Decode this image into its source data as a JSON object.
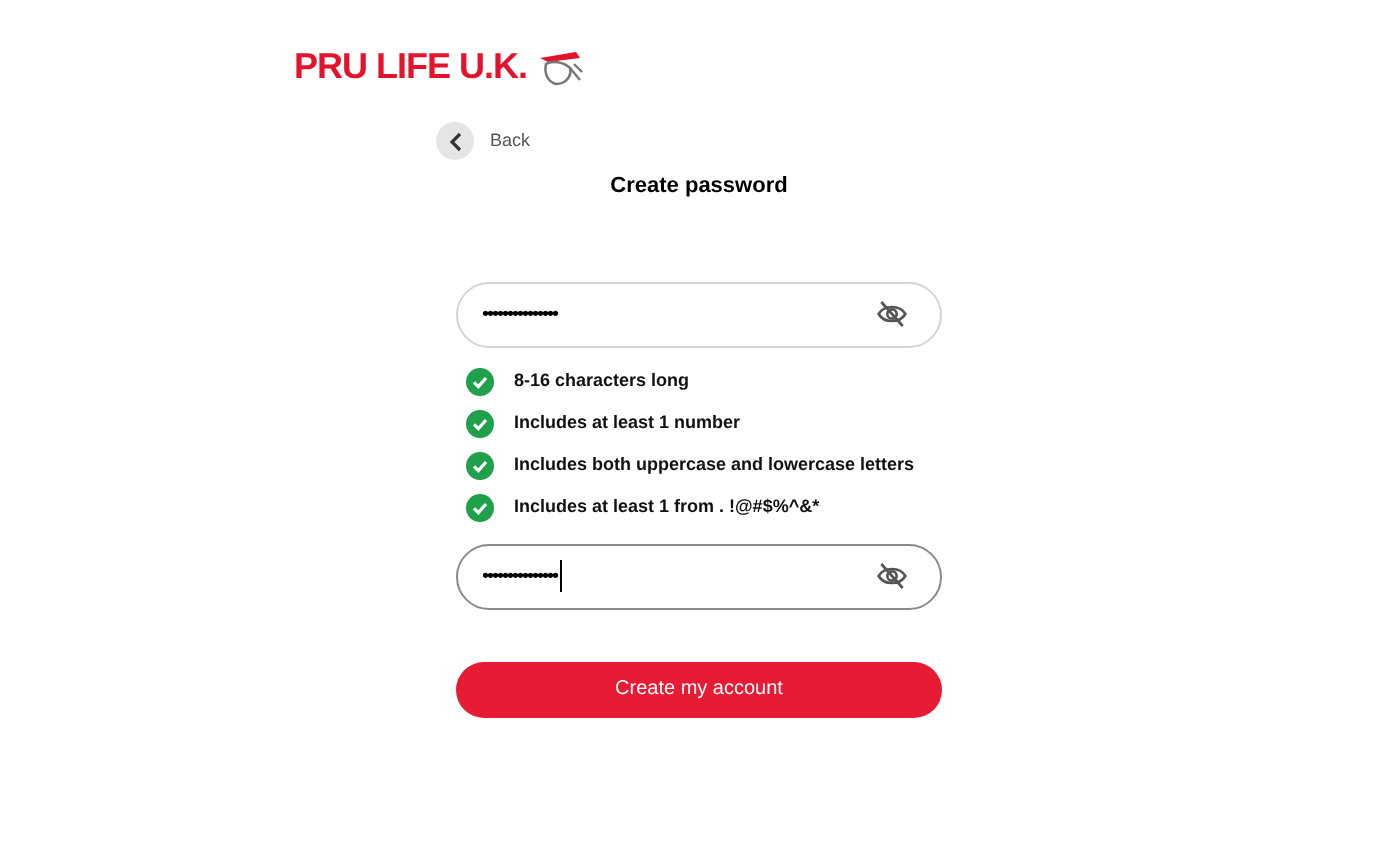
{
  "logo": {
    "text": "PRU LIFE U.K."
  },
  "back": {
    "label": "Back"
  },
  "title": "Create password",
  "password_fields": [
    {
      "value": "•••••••••••••••",
      "focused": false
    },
    {
      "value": "•••••••••••••••",
      "focused": true
    }
  ],
  "requirements": [
    {
      "text": "8-16 characters long",
      "met": true
    },
    {
      "text": "Includes at least 1 number",
      "met": true
    },
    {
      "text": "Includes both uppercase and lowercase letters",
      "met": true
    },
    {
      "text": "Includes at least 1 from . !@#$%^&*",
      "met": true
    }
  ],
  "submit": {
    "label": "Create my account"
  }
}
